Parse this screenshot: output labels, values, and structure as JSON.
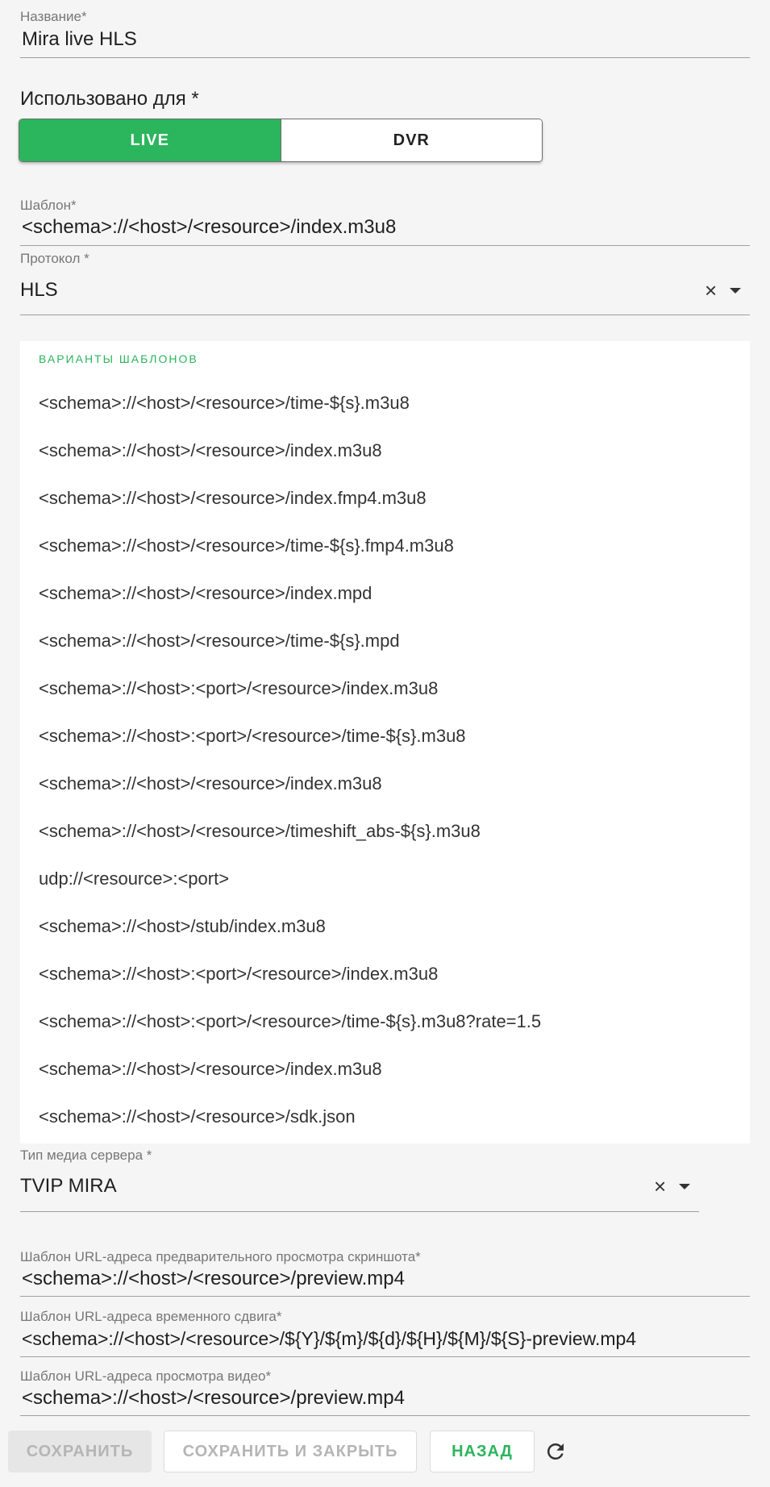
{
  "name_field": {
    "label": "Название*",
    "value": "Mira live HLS"
  },
  "used_for": {
    "title": "Использовано для *",
    "options": [
      "LIVE",
      "DVR"
    ],
    "selected": "LIVE"
  },
  "template_field": {
    "label": "Шаблон*",
    "value": "<schema>://<host>/<resource>/index.m3u8"
  },
  "protocol_field": {
    "label": "Протокол *",
    "value": "HLS",
    "clear_icon": "close-icon",
    "dropdown_icon": "chevron-down-icon"
  },
  "template_variants": {
    "header": "ВАРИАНТЫ ШАБЛОНОВ",
    "items": [
      "<schema>://<host>/<resource>/time-${s}.m3u8",
      "<schema>://<host>/<resource>/index.m3u8",
      "<schema>://<host>/<resource>/index.fmp4.m3u8",
      "<schema>://<host>/<resource>/time-${s}.fmp4.m3u8",
      "<schema>://<host>/<resource>/index.mpd",
      "<schema>://<host>/<resource>/time-${s}.mpd",
      "<schema>://<host>:<port>/<resource>/index.m3u8",
      "<schema>://<host>:<port>/<resource>/time-${s}.m3u8",
      "<schema>://<host>/<resource>/index.m3u8",
      "<schema>://<host>/<resource>/timeshift_abs-${s}.m3u8",
      "udp://<resource>:<port>",
      "<schema>://<host>/stub/index.m3u8",
      "<schema>://<host>:<port>/<resource>/index.m3u8",
      "<schema>://<host>:<port>/<resource>/time-${s}.m3u8?rate=1.5",
      "<schema>://<host>/<resource>/index.m3u8",
      "<schema>://<host>/<resource>/sdk.json"
    ]
  },
  "media_server_field": {
    "label": "Тип медиа сервера *",
    "value": "TVIP MIRA"
  },
  "preview_screenshot_field": {
    "label": "Шаблон URL-адреса предварительного просмотра скриншота*",
    "value": "<schema>://<host>/<resource>/preview.mp4"
  },
  "timeshift_field": {
    "label": "Шаблон URL-адреса временного сдвига*",
    "value": "<schema>://<host>/<resource>/${Y}/${m}/${d}/${H}/${M}/${S}-preview.mp4"
  },
  "video_preview_field": {
    "label": "Шаблон URL-адреса просмотра видео*",
    "value": "<schema>://<host>/<resource>/preview.mp4"
  },
  "actions": {
    "save": "СОХРАНИТЬ",
    "save_and_close": "СОХРАНИТЬ И ЗАКРЫТЬ",
    "back": "НАЗАД",
    "refresh_icon": "refresh-icon"
  },
  "colors": {
    "accent": "#2bb55d",
    "disabled_text": "#b5b5b5",
    "background": "#f5f5f5"
  }
}
